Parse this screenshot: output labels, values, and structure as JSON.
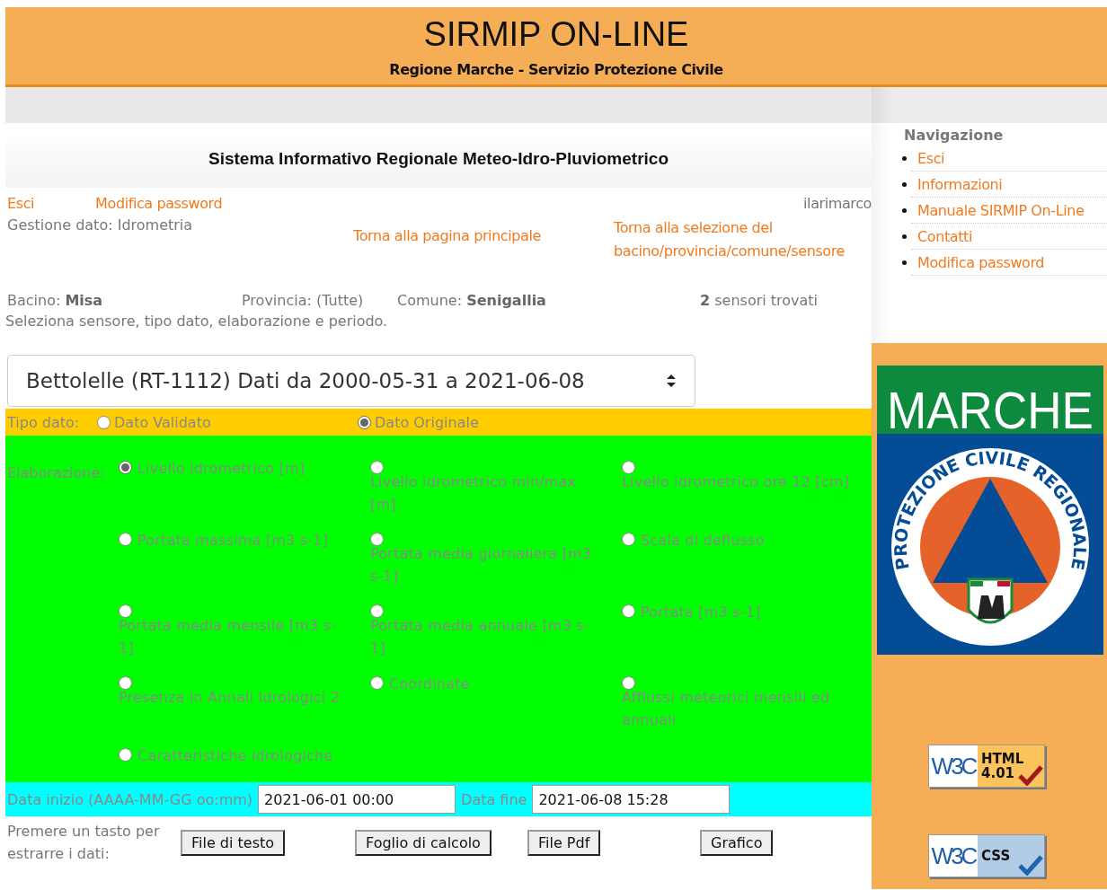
{
  "header": {
    "title": "SIRMIP ON-LINE",
    "subtitle": "Regione Marche - Servizio Protezione Civile"
  },
  "system_title": "Sistema Informativo Regionale Meteo-Idro-Pluviometrico",
  "top_links": [
    "Esci",
    "Modifica password"
  ],
  "user": "ilarimarco",
  "management": "Gestione dato: Idrometria",
  "nav_links": [
    "Torna alla pagina principale",
    "Torna alla selezione del bacino/provincia/comune/sensore"
  ],
  "filters": [
    "Bacino: **Misa**",
    "Provincia: (Tutte)",
    "Comune: **Senigallia**",
    "**2** sensori trovati"
  ],
  "instruction": "Seleziona sensore, tipo dato, elaborazione e periodo.",
  "sensor_select": {
    "value": "Bettolelle (RT-1112) Dati da 2000-05-31 a 2021-06-08"
  },
  "data_type": {
    "label": "Tipo dato:",
    "options": [
      {
        "label": "Dato Validato",
        "selected": false
      },
      {
        "label": "Dato Originale",
        "selected": true
      }
    ]
  },
  "elaboration": {
    "label": "Elaborazione:",
    "options": [
      {
        "label": "Livello idrometrico [m]",
        "selected": true
      },
      {
        "label": "Livello idrometrico min/max [m]",
        "selected": false
      },
      {
        "label": "Livello idrometrico ore 12 [cm]",
        "selected": false
      },
      {
        "label": "Portata massima [m3 s-1]",
        "selected": false
      },
      {
        "label": "Portata media giornaliera [m3 s-1]",
        "selected": false
      },
      {
        "label": "Scala di deflusso",
        "selected": false
      },
      {
        "label": "Portata media mensile [m3 s-1]",
        "selected": false
      },
      {
        "label": "Portata media annuale [m3 s-1]",
        "selected": false
      },
      {
        "label": "Portata [m3 s-1]",
        "selected": false
      },
      {
        "label": "Presenza in Annali Idrologici 2",
        "selected": false
      },
      {
        "label": "Coordinate",
        "selected": false
      },
      {
        "label": "Afflussi meteorici mensili ed annuali",
        "selected": false
      },
      {
        "label": "Caratteristiche idrologiche",
        "selected": false
      }
    ]
  },
  "period": {
    "start_label": "Data inizio (AAAA-MM-GG oo:mm)",
    "start_value": "2021-06-01 00:00",
    "end_label": "Data fine",
    "end_value": "2021-06-08 15:28"
  },
  "export": {
    "prompt": "Premere un tasto per estrarre i dati:",
    "buttons": [
      "File di testo",
      "Foglio di calcolo",
      "File Pdf",
      "Grafico"
    ]
  },
  "sidebar": {
    "title": "Navigazione",
    "items": [
      "Esci",
      "Informazioni",
      "Manuale SIRMIP On-Line",
      "Contatti",
      "Modifica password"
    ]
  },
  "logo": {
    "title": "MARCHE",
    "ring_text": "PROTEZIONE CIVILE REGIONALE"
  },
  "badges": [
    {
      "kind": "html",
      "mark": "W3C",
      "label": "HTML",
      "version": "4.01"
    },
    {
      "kind": "css",
      "mark": "W3C",
      "label": "CSS"
    }
  ]
}
